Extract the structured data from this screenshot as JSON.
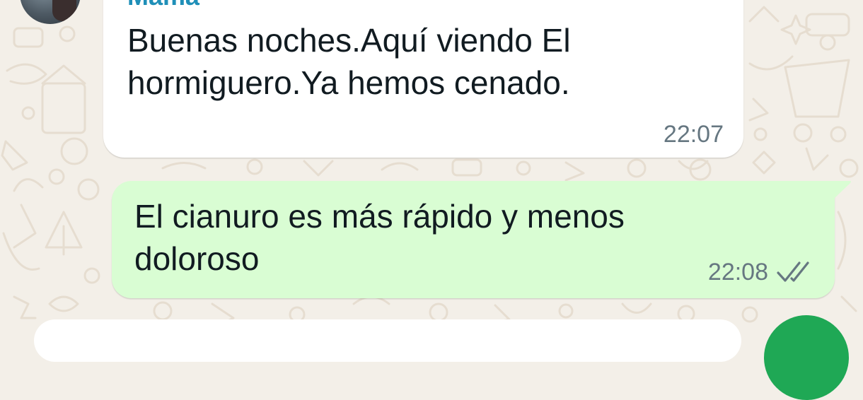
{
  "conversation": {
    "contact_avatar_icon": "contact-photo",
    "messages": [
      {
        "direction": "incoming",
        "sender": "Mamá",
        "text": "Buenas noches.Aquí viendo El\nhormiguero.Ya hemos cenado.",
        "time": "22:07"
      },
      {
        "direction": "outgoing",
        "text": "El cianuro es más rápido y menos\ndoloroso",
        "time": "22:08",
        "status_icon": "double-check-icon",
        "status": "delivered"
      }
    ]
  },
  "colors": {
    "background": "#f3efe8",
    "incoming_bubble": "#ffffff",
    "outgoing_bubble": "#d9fdd3",
    "sender_name": "#1f8fb8",
    "timestamp": "#667781",
    "send_button": "#1fa855"
  },
  "composer": {
    "send_icon": "send-icon"
  }
}
